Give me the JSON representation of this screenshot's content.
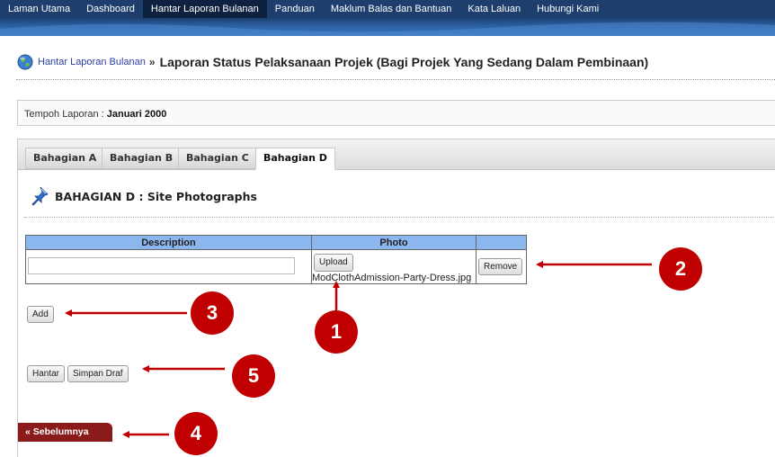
{
  "nav": {
    "items": [
      "Laman Utama",
      "Dashboard",
      "Hantar Laporan Bulanan",
      "Panduan",
      "Maklum Balas dan Bantuan",
      "Kata Laluan",
      "Hubungi Kami"
    ],
    "active_index": 2
  },
  "header": {
    "breadcrumb": "Hantar Laporan Bulanan",
    "separator": "»",
    "title": "Laporan Status Pelaksanaan Projek (Bagi Projek Yang Sedang Dalam Pembinaan)"
  },
  "period": {
    "label": "Tempoh Laporan :",
    "value": "Januari 2000"
  },
  "tabs": [
    {
      "label": "Bahagian A",
      "active": false
    },
    {
      "label": "Bahagian B",
      "active": false
    },
    {
      "label": "Bahagian C",
      "active": false
    },
    {
      "label": "Bahagian D",
      "active": true
    }
  ],
  "section": {
    "title": "BAHAGIAN D : Site Photographs"
  },
  "table": {
    "headers": [
      "Description",
      "Photo",
      ""
    ],
    "row": {
      "description_value": "",
      "upload_label": "Upload",
      "filename": "ModClothAdmission-Party-Dress.jpg",
      "remove_label": "Remove"
    }
  },
  "buttons": {
    "add": "Add",
    "hantar": "Hantar",
    "simpan_draf": "Simpan Draf",
    "sebelumnya": "« Sebelumnya"
  },
  "annotations": [
    "1",
    "2",
    "3",
    "4",
    "5"
  ],
  "colors": {
    "annotation": "#c00000",
    "nav_bg": "#1e3f6d",
    "table_header": "#8cb6ee",
    "prev_button": "#8b1a1a"
  },
  "icons": {
    "title": "globe-icon",
    "section": "pushpin-icon"
  }
}
